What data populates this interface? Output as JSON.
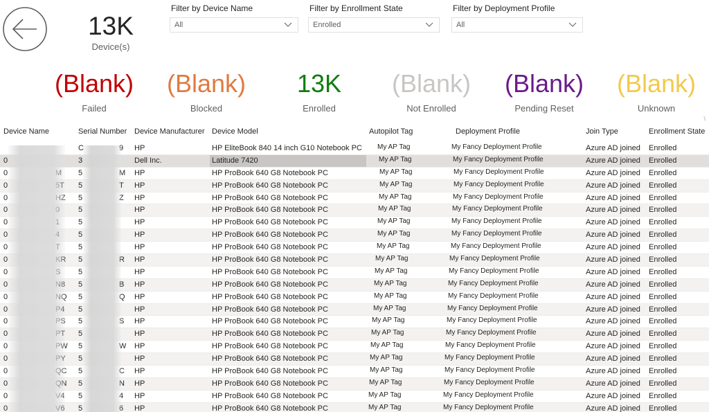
{
  "header": {
    "device_count": "13K",
    "device_count_label": "Device(s)"
  },
  "icons": {
    "back": "arrow-left-circle-icon",
    "dropdown": "chevron-down-icon"
  },
  "filters": [
    {
      "title": "Filter by Device Name",
      "value": "All"
    },
    {
      "title": "Filter by Enrollment State",
      "value": "Enrolled"
    },
    {
      "title": "Filter by Deployment Profile",
      "value": "All"
    }
  ],
  "kpis": [
    {
      "value": "(Blank)",
      "label": "Failed",
      "color": "#c00000"
    },
    {
      "value": "(Blank)",
      "label": "Blocked",
      "color": "#e07a3f"
    },
    {
      "value": "13K",
      "label": "Enrolled",
      "color": "#107c10"
    },
    {
      "value": "(Blank)",
      "label": "Not Enrolled",
      "color": "#c8c6c4"
    },
    {
      "value": "(Blank)",
      "label": "Pending Reset",
      "color": "#6b1a8a"
    },
    {
      "value": "(Blank)",
      "label": "Unknown",
      "color": "#f2c94c"
    }
  ],
  "table": {
    "columns": [
      "Device Name",
      "Serial Number",
      "Device Manufacturer",
      "Device Model",
      "Autopilot Tag",
      "Deployment Profile",
      "Join Type",
      "Enrollment State"
    ],
    "rows": [
      {
        "name": "",
        "serial": "C",
        "serial_end": "9",
        "mfr": "HP",
        "model": "HP EliteBook 840 14 inch G10 Notebook PC",
        "ap": "My AP Tag",
        "profile": "My Fancy Deployment Profile",
        "join": "Azure AD joined",
        "state": "Enrolled"
      },
      {
        "name": "0",
        "serial": "3",
        "serial_end": "",
        "mfr": "Dell Inc.",
        "model": "Latitude 7420",
        "ap": "My AP Tag",
        "profile": "My Fancy Deployment Profile",
        "join": "Azure AD joined",
        "state": "Enrolled"
      },
      {
        "name": "0",
        "name_end": "M",
        "serial": "5",
        "serial_end": "M",
        "mfr": "HP",
        "model": "HP ProBook 640 G8 Notebook PC",
        "ap": "My AP Tag",
        "profile": "My Fancy Deployment Profile",
        "join": "Azure AD joined",
        "state": "Enrolled"
      },
      {
        "name": "0",
        "name_end": "5T",
        "serial": "5",
        "serial_end": "T",
        "mfr": "HP",
        "model": "HP ProBook 640 G8 Notebook PC",
        "ap": "My AP Tag",
        "profile": "My Fancy Deployment Profile",
        "join": "Azure AD joined",
        "state": "Enrolled"
      },
      {
        "name": "0",
        "name_end": "HZ",
        "serial": "5",
        "serial_end": "Z",
        "mfr": "HP",
        "model": "HP ProBook 640 G8 Notebook PC",
        "ap": "My AP Tag",
        "profile": "My Fancy Deployment Profile",
        "join": "Azure AD joined",
        "state": "Enrolled"
      },
      {
        "name": "0",
        "name_end": "0",
        "serial": "5",
        "serial_end": "",
        "mfr": "HP",
        "model": "HP ProBook 640 G8 Notebook PC",
        "ap": "My AP Tag",
        "profile": "My Fancy Deployment Profile",
        "join": "Azure AD joined",
        "state": "Enrolled"
      },
      {
        "name": "0",
        "name_end": "1",
        "serial": "5",
        "serial_end": "",
        "mfr": "HP",
        "model": "HP ProBook 640 G8 Notebook PC",
        "ap": "My AP Tag",
        "profile": "My Fancy Deployment Profile",
        "join": "Azure AD joined",
        "state": "Enrolled"
      },
      {
        "name": "0",
        "name_end": "4",
        "serial": "5",
        "serial_end": "",
        "mfr": "HP",
        "model": "HP ProBook 640 G8 Notebook PC",
        "ap": "My AP Tag",
        "profile": "My Fancy Deployment Profile",
        "join": "Azure AD joined",
        "state": "Enrolled"
      },
      {
        "name": "0",
        "name_end": "T",
        "serial": "5",
        "serial_end": "",
        "mfr": "HP",
        "model": "HP ProBook 640 G8 Notebook PC",
        "ap": "My AP Tag",
        "profile": "My Fancy Deployment Profile",
        "join": "Azure AD joined",
        "state": "Enrolled"
      },
      {
        "name": "0",
        "name_end": "KR",
        "serial": "5",
        "serial_end": "R",
        "mfr": "HP",
        "model": "HP ProBook 640 G8 Notebook PC",
        "ap": "My AP Tag",
        "profile": "My Fancy Deployment Profile",
        "join": "Azure AD joined",
        "state": "Enrolled"
      },
      {
        "name": "0",
        "name_end": "S",
        "serial": "5",
        "serial_end": "",
        "mfr": "HP",
        "model": "HP ProBook 640 G8 Notebook PC",
        "ap": "My AP Tag",
        "profile": "My Fancy Deployment Profile",
        "join": "Azure AD joined",
        "state": "Enrolled"
      },
      {
        "name": "0",
        "name_end": "N8",
        "serial": "5",
        "serial_end": "B",
        "mfr": "HP",
        "model": "HP ProBook 640 G8 Notebook PC",
        "ap": "My AP Tag",
        "profile": "My Fancy Deployment Profile",
        "join": "Azure AD joined",
        "state": "Enrolled"
      },
      {
        "name": "0",
        "name_end": "NQ",
        "serial": "5",
        "serial_end": "Q",
        "mfr": "HP",
        "model": "HP ProBook 640 G8 Notebook PC",
        "ap": "My AP Tag",
        "profile": "My Fancy Deployment Profile",
        "join": "Azure AD joined",
        "state": "Enrolled"
      },
      {
        "name": "0",
        "name_end": "P4",
        "serial": "5",
        "serial_end": "",
        "mfr": "HP",
        "model": "HP ProBook 640 G8 Notebook PC",
        "ap": "My AP Tag",
        "profile": "My Fancy Deployment Profile",
        "join": "Azure AD joined",
        "state": "Enrolled"
      },
      {
        "name": "0",
        "name_end": "PS",
        "serial": "5",
        "serial_end": "S",
        "mfr": "HP",
        "model": "HP ProBook 640 G8 Notebook PC",
        "ap": "My AP Tag",
        "profile": "My Fancy Deployment Profile",
        "join": "Azure AD joined",
        "state": "Enrolled"
      },
      {
        "name": "0",
        "name_end": "PT",
        "serial": "5",
        "serial_end": "",
        "mfr": "HP",
        "model": "HP ProBook 640 G8 Notebook PC",
        "ap": "My AP Tag",
        "profile": "My Fancy Deployment Profile",
        "join": "Azure AD joined",
        "state": "Enrolled"
      },
      {
        "name": "0",
        "name_end": "PW",
        "serial": "5",
        "serial_end": "W",
        "mfr": "HP",
        "model": "HP ProBook 640 G8 Notebook PC",
        "ap": "My AP Tag",
        "profile": "My Fancy Deployment Profile",
        "join": "Azure AD joined",
        "state": "Enrolled"
      },
      {
        "name": "0",
        "name_end": "PY",
        "serial": "5",
        "serial_end": "",
        "mfr": "HP",
        "model": "HP ProBook 640 G8 Notebook PC",
        "ap": "My AP Tag",
        "profile": "My Fancy Deployment Profile",
        "join": "Azure AD joined",
        "state": "Enrolled"
      },
      {
        "name": "0",
        "name_end": "QC",
        "serial": "5",
        "serial_end": "C",
        "mfr": "HP",
        "model": "HP ProBook 640 G8 Notebook PC",
        "ap": "My AP Tag",
        "profile": "My Fancy Deployment Profile",
        "join": "Azure AD joined",
        "state": "Enrolled"
      },
      {
        "name": "0",
        "name_end": "QN",
        "serial": "5",
        "serial_end": "N",
        "mfr": "HP",
        "model": "HP ProBook 640 G8 Notebook PC",
        "ap": "My AP Tag",
        "profile": "My Fancy Deployment Profile",
        "join": "Azure AD joined",
        "state": "Enrolled"
      },
      {
        "name": "0",
        "name_end": "V4",
        "serial": "5",
        "serial_end": "4",
        "mfr": "HP",
        "model": "HP ProBook 640 G8 Notebook PC",
        "ap": "My AP Tag",
        "profile": "My Fancy Deployment Profile",
        "join": "Azure AD joined",
        "state": "Enrolled"
      },
      {
        "name": "0",
        "name_end": "V6",
        "serial": "5",
        "serial_end": "6",
        "mfr": "HP",
        "model": "HP ProBook 640 G8 Notebook PC",
        "ap": "My AP Tag",
        "profile": "My Fancy Deployment Profile",
        "join": "Azure AD joined",
        "state": "Enrolled"
      }
    ]
  }
}
